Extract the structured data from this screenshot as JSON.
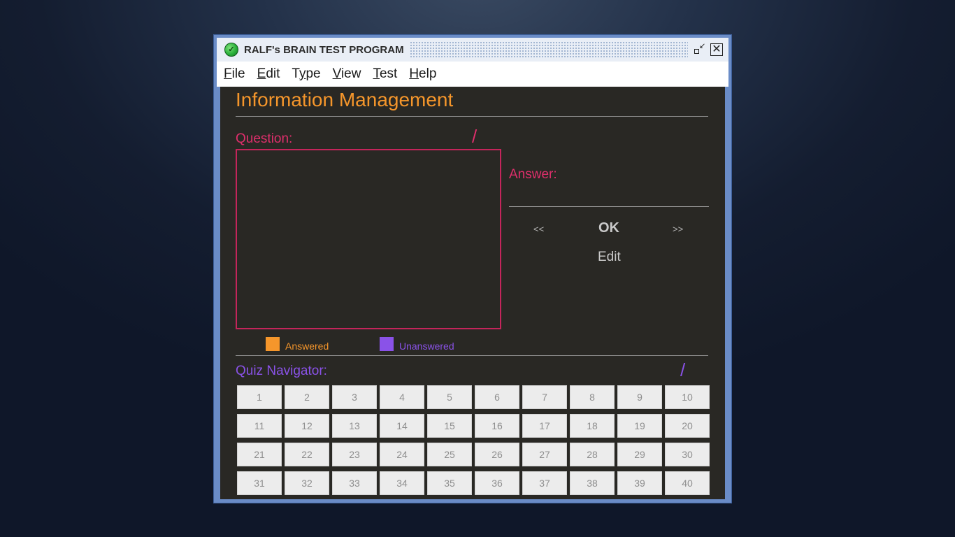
{
  "window": {
    "title": "RALF's BRAIN TEST PROGRAM",
    "app_icon_glyph": "✓",
    "restore_icon": "restore-icon",
    "close_icon": "close-icon",
    "close_glyph": "✕"
  },
  "menu": {
    "items": [
      {
        "mnemonic": "F",
        "rest": "ile"
      },
      {
        "mnemonic": "E",
        "rest": "dit"
      },
      {
        "pre": "T",
        "mnemonic": "y",
        "rest": "pe"
      },
      {
        "mnemonic": "V",
        "rest": "iew"
      },
      {
        "mnemonic": "T",
        "rest": "est"
      },
      {
        "mnemonic": "H",
        "rest": "elp"
      }
    ]
  },
  "main": {
    "page_title": "Information Management",
    "question_label": "Question:",
    "question_counter": "/",
    "answer_label": "Answer:",
    "prev_label": "<<",
    "ok_label": "OK",
    "next_label": ">>",
    "edit_label": "Edit",
    "legend": {
      "answered_label": "Answered",
      "unanswered_label": "Unanswered"
    },
    "quiz_navigator_label": "Quiz Navigator:",
    "quiz_counter": "/",
    "question_numbers": [
      "1",
      "2",
      "3",
      "4",
      "5",
      "6",
      "7",
      "8",
      "9",
      "10",
      "11",
      "12",
      "13",
      "14",
      "15",
      "16",
      "17",
      "18",
      "19",
      "20",
      "21",
      "22",
      "23",
      "24",
      "25",
      "26",
      "27",
      "28",
      "29",
      "30",
      "31",
      "32",
      "33",
      "34",
      "35",
      "36",
      "37",
      "38",
      "39",
      "40"
    ]
  },
  "colors": {
    "answered": "#f5962b",
    "unanswered": "#8a52e8",
    "question_accent": "#e02f6c",
    "panel_bg": "#292824"
  }
}
